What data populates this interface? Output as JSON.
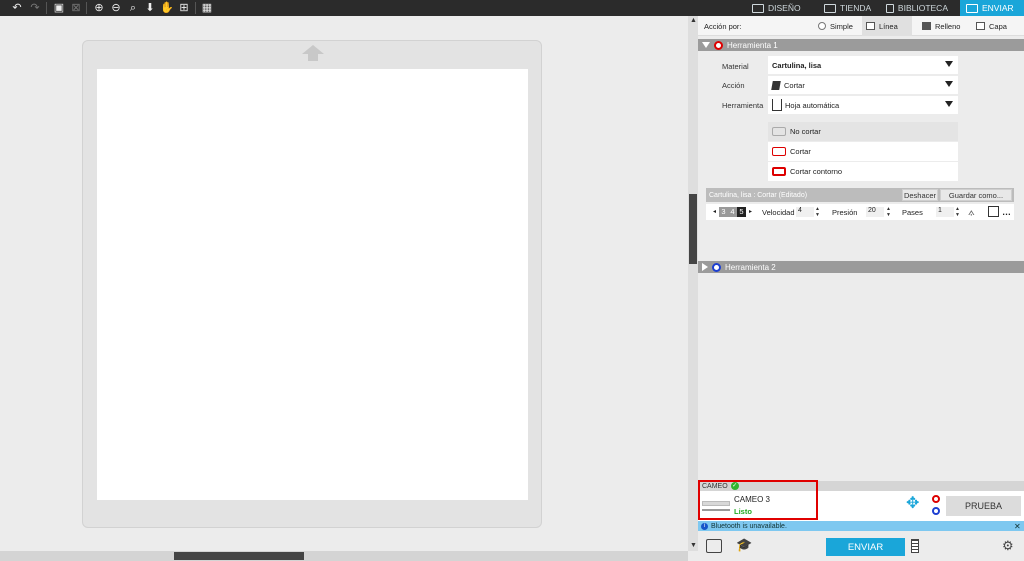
{
  "nav": {
    "tabs": [
      {
        "label": "DISEÑO"
      },
      {
        "label": "TIENDA"
      },
      {
        "label": "BIBLIOTECA"
      },
      {
        "label": "ENVIAR"
      }
    ],
    "active_color": "#1aa6d9"
  },
  "action_bar": {
    "label": "Acción por:",
    "options": [
      "Simple",
      "Línea",
      "Relleno",
      "Capa"
    ],
    "selected": "Línea"
  },
  "tool1": {
    "header": "Herramienta 1",
    "material_label": "Material",
    "material_value": "Cartulina, lisa",
    "accion_label": "Acción",
    "accion_value": "Cortar",
    "herramienta_label": "Herramienta",
    "herramienta_value": "Hoja automática",
    "cut_options": [
      "No cortar",
      "Cortar",
      "Cortar contorno"
    ],
    "cut_selected": "No cortar",
    "preset_label": "Cartulina, lisa : Cortar (Editado)",
    "deshacer": "Deshacer",
    "guardar": "Guardar como...",
    "blade_digits": [
      "3",
      "4",
      "5"
    ],
    "velocidad_label": "Velocidad",
    "velocidad_value": "4",
    "presion_label": "Presión",
    "presion_value": "20",
    "pases_label": "Pases",
    "pases_value": "1",
    "ring_color": "#dd0000"
  },
  "tool2": {
    "header": "Herramienta 2",
    "ring_color": "#1d3fd1"
  },
  "machine": {
    "section": "CAMEO",
    "name": "CAMEO 3",
    "status": "Listo",
    "status_color": "#22aa22",
    "test_button": "PRUEBA"
  },
  "bluetooth": {
    "message": "Bluetooth is unavailable."
  },
  "footer": {
    "send_button": "ENVIAR"
  }
}
